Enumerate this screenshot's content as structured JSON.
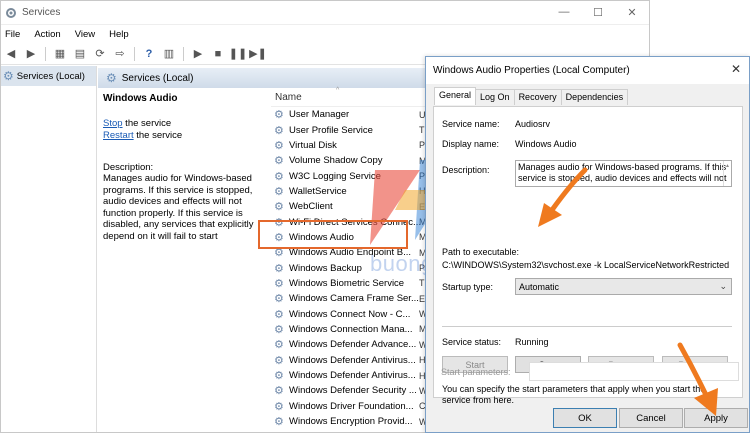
{
  "window": {
    "title": "Services",
    "controls": [
      "—",
      "☐",
      "✕"
    ]
  },
  "menu": [
    "File",
    "Action",
    "View",
    "Help"
  ],
  "tree": {
    "item": "Services (Local)"
  },
  "content_header": "Services (Local)",
  "detail": {
    "service_name": "Windows Audio",
    "stop_link": "Stop",
    "stop_suffix": " the service",
    "restart_link": "Restart",
    "restart_suffix": " the service",
    "description_label": "Description:",
    "description": "Manages audio for Windows-based programs.  If this service is stopped, audio devices and effects will not function properly.  If this service is disabled, any services that explicitly depend on it will fail to start"
  },
  "list": {
    "column_name": "Name",
    "rows": [
      {
        "name": "User Manager",
        "col": "U"
      },
      {
        "name": "User Profile Service",
        "col": "T"
      },
      {
        "name": "Virtual Disk",
        "col": "P"
      },
      {
        "name": "Volume Shadow Copy",
        "col": "M"
      },
      {
        "name": "W3C Logging Service",
        "col": "P"
      },
      {
        "name": "WalletService",
        "col": "H"
      },
      {
        "name": "WebClient",
        "col": "E"
      },
      {
        "name": "Wi-Fi Direct Services Connec...",
        "col": "M"
      },
      {
        "name": "Windows Audio",
        "col": "M"
      },
      {
        "name": "Windows Audio Endpoint B...",
        "col": "M"
      },
      {
        "name": "Windows Backup",
        "col": "P"
      },
      {
        "name": "Windows Biometric Service",
        "col": "T"
      },
      {
        "name": "Windows Camera Frame Ser...",
        "col": "E"
      },
      {
        "name": "Windows Connect Now - C...",
        "col": "W"
      },
      {
        "name": "Windows Connection Mana...",
        "col": "M"
      },
      {
        "name": "Windows Defender Advance...",
        "col": "W"
      },
      {
        "name": "Windows Defender Antivirus...",
        "col": "H"
      },
      {
        "name": "Windows Defender Antivirus...",
        "col": "H"
      },
      {
        "name": "Windows Defender Security ...",
        "col": "W"
      },
      {
        "name": "Windows Driver Foundation...",
        "col": "C"
      },
      {
        "name": "Windows Encryption Provid...",
        "col": "W"
      }
    ]
  },
  "watermark": "buongtrangki.com",
  "dialog": {
    "title": "Windows Audio Properties (Local Computer)",
    "close": "✕",
    "tabs": [
      "General",
      "Log On",
      "Recovery",
      "Dependencies"
    ],
    "service_name_label": "Service name:",
    "service_name_value": "Audiosrv",
    "display_name_label": "Display name:",
    "display_name_value": "Windows Audio",
    "description_label": "Description:",
    "description_value": "Manages audio for Windows-based programs.  If this service is stopped, audio devices and effects will not",
    "path_label": "Path to executable:",
    "path_value": "C:\\WINDOWS\\System32\\svchost.exe -k LocalServiceNetworkRestricted",
    "startup_label": "Startup type:",
    "startup_value": "Automatic",
    "status_label": "Service status:",
    "status_value": "Running",
    "buttons": {
      "start": "Start",
      "stop": "Stop",
      "pause": "Pause",
      "resume": "Resume"
    },
    "hint": "You can specify the start parameters that apply when you start the service from here.",
    "params_label": "Start parameters:",
    "ok": "OK",
    "cancel": "Cancel",
    "apply": "Apply"
  },
  "colors": {
    "accent_arrow": "#ef7a1f",
    "highlight": "#e4682c",
    "link": "#1a5bb5"
  }
}
